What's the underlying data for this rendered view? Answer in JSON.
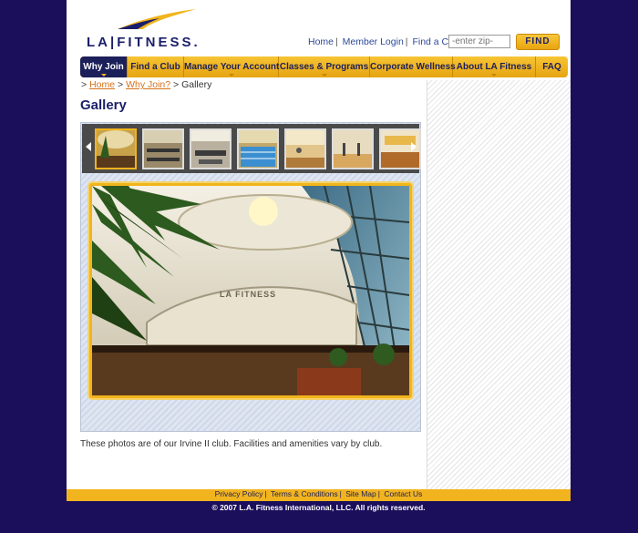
{
  "brand": {
    "logo_text": "LA|FITNESS.",
    "accent": "#f2b41e",
    "navy": "#1b1f6b",
    "background": "#1b0f5c"
  },
  "header": {
    "links": [
      "Home",
      "Member Login",
      "Find a Club"
    ],
    "search": {
      "placeholder": "-enter zip-",
      "value": ""
    },
    "find_label": "FIND"
  },
  "nav": {
    "items": [
      {
        "label": "Why Join",
        "active": true
      },
      {
        "label": "Find a Club",
        "active": false
      },
      {
        "label": "Manage Your Account",
        "active": false
      },
      {
        "label": "Classes & Programs",
        "active": false
      },
      {
        "label": "Corporate Wellness",
        "active": false
      },
      {
        "label": "About LA Fitness",
        "active": false
      },
      {
        "label": "FAQ",
        "active": false
      }
    ]
  },
  "breadcrumb": {
    "prefix": ">",
    "home": "Home",
    "sep1": ">",
    "why_join": "Why Join?",
    "sep2": ">",
    "current": "Gallery"
  },
  "page_title": "Gallery",
  "gallery": {
    "thumbnails": [
      "atrium-icon",
      "gym-floor-icon",
      "weights-icon",
      "pool-icon",
      "studio-icon",
      "court-icon",
      "lobby-icon"
    ],
    "selected_index": 0
  },
  "caption": "These photos are of our Irvine II club. Facilities and amenities vary by club.",
  "footer": {
    "links": [
      "Privacy Policy",
      "Terms & Conditions",
      "Site Map",
      "Contact Us"
    ],
    "copyright": "© 2007 L.A. Fitness International, LLC. All rights reserved."
  }
}
